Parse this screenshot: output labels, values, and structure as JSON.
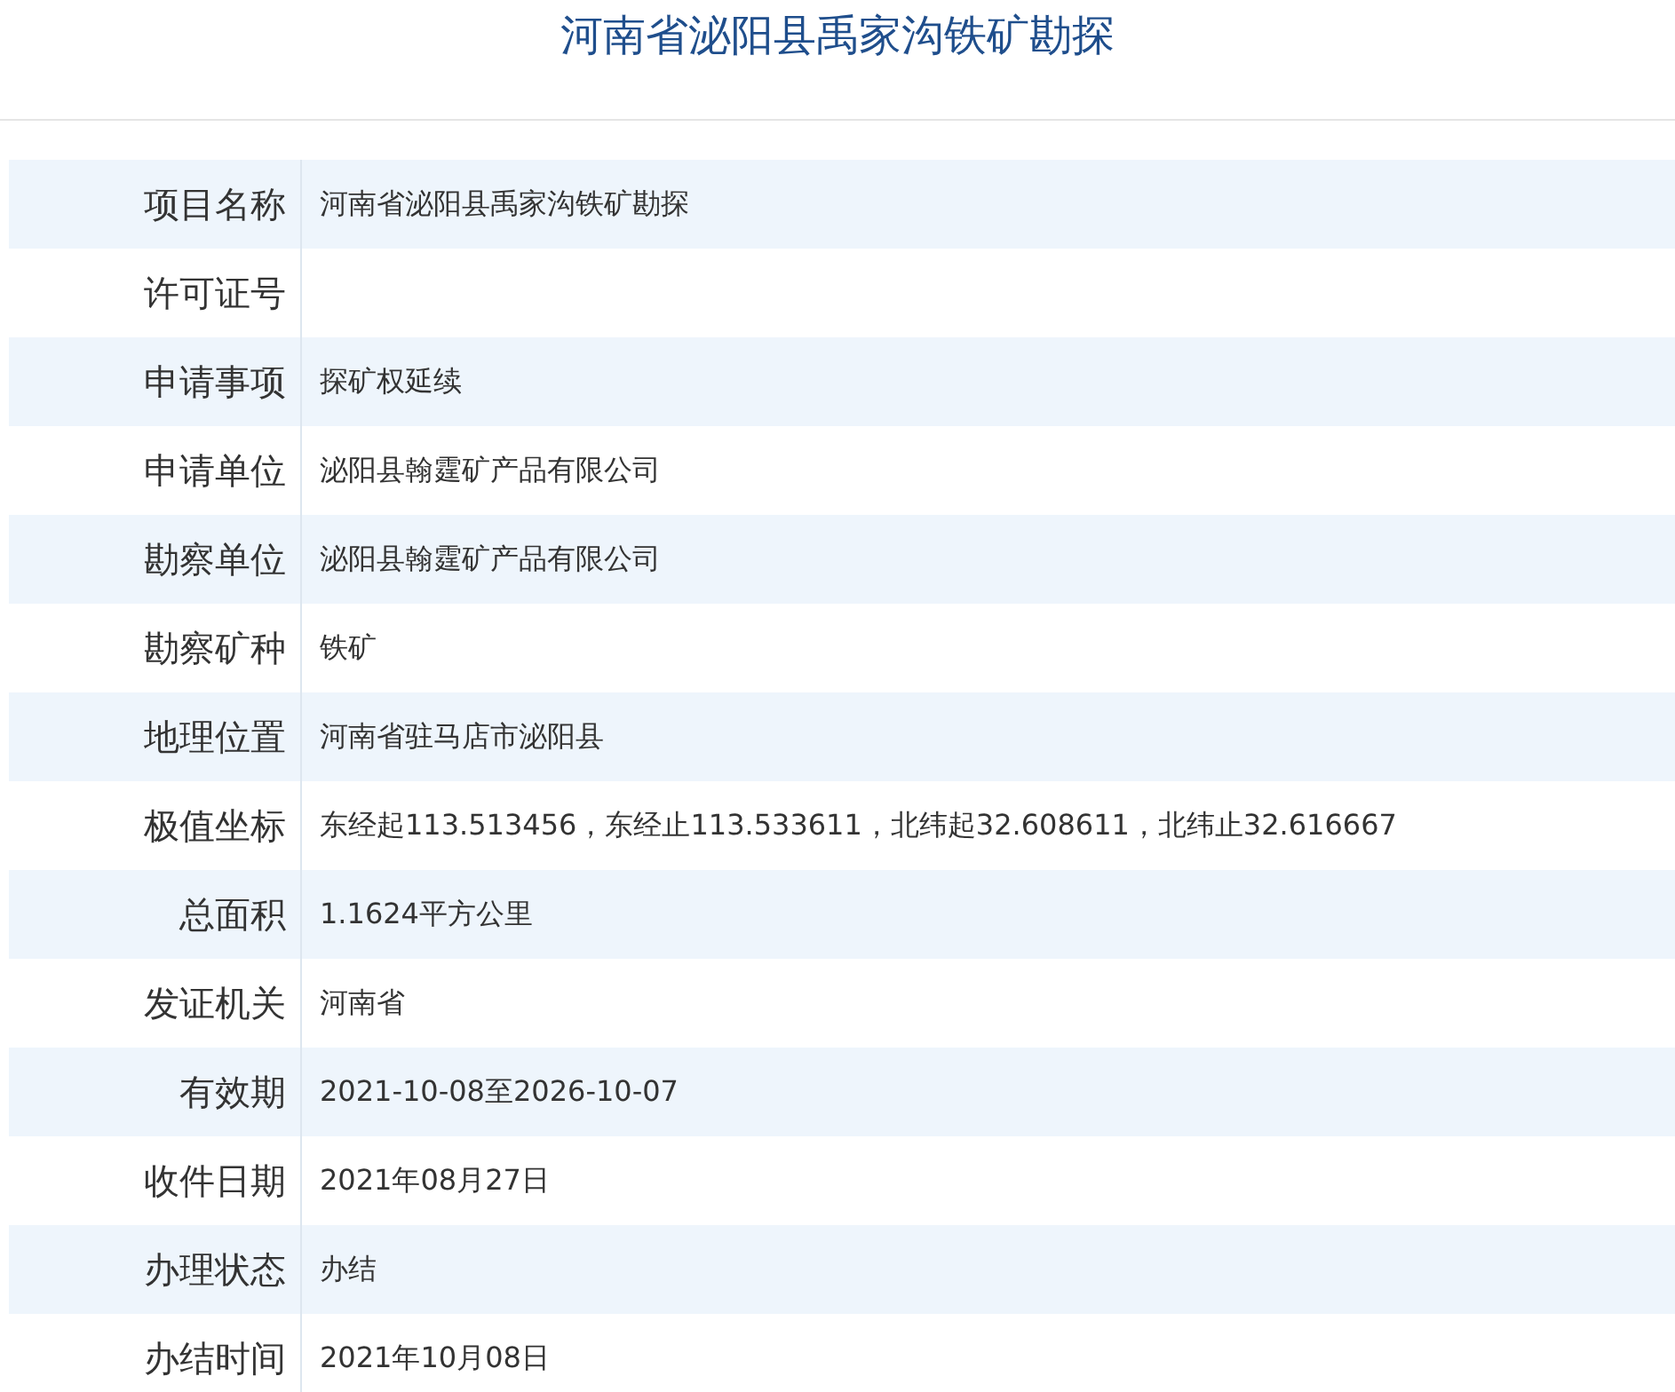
{
  "title": "河南省泌阳县禹家沟铁矿勘探",
  "rows": [
    {
      "label": "项目名称",
      "value": "河南省泌阳县禹家沟铁矿勘探"
    },
    {
      "label": "许可证号",
      "value": ""
    },
    {
      "label": "申请事项",
      "value": "探矿权延续"
    },
    {
      "label": "申请单位",
      "value": "泌阳县翰霆矿产品有限公司"
    },
    {
      "label": "勘察单位",
      "value": "泌阳县翰霆矿产品有限公司"
    },
    {
      "label": "勘察矿种",
      "value": "铁矿"
    },
    {
      "label": "地理位置",
      "value": "河南省驻马店市泌阳县"
    },
    {
      "label": "极值坐标",
      "value": "东经起113.513456，东经止113.533611，北纬起32.608611，北纬止32.616667"
    },
    {
      "label": "总面积",
      "value": "1.1624平方公里"
    },
    {
      "label": "发证机关",
      "value": "河南省"
    },
    {
      "label": "有效期",
      "value": "2021-10-08至2026-10-07"
    },
    {
      "label": "收件日期",
      "value": "2021年08月27日"
    },
    {
      "label": "办理状态",
      "value": "办结"
    },
    {
      "label": "办结时间",
      "value": "2021年10月08日"
    }
  ]
}
